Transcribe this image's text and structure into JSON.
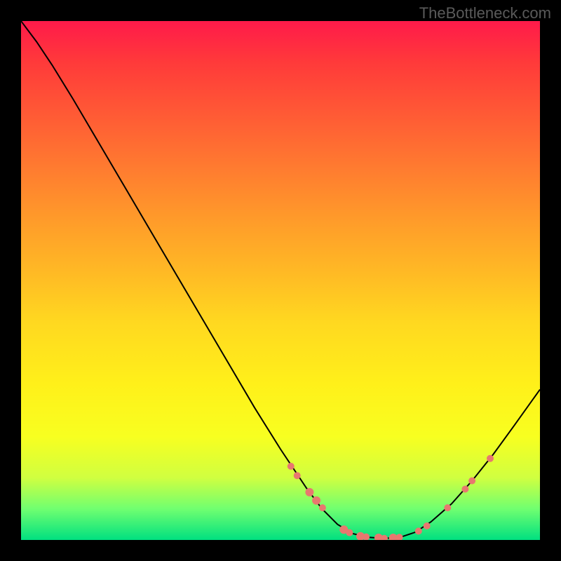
{
  "watermark": "TheBottleneck.com",
  "chart_data": {
    "type": "line",
    "title": "",
    "xlabel": "",
    "ylabel": "",
    "xlim": [
      0,
      100
    ],
    "ylim": [
      0,
      100
    ],
    "curve": {
      "points": [
        {
          "x": 0.0,
          "y": 100.0
        },
        {
          "x": 3.0,
          "y": 96.0
        },
        {
          "x": 6.0,
          "y": 91.5
        },
        {
          "x": 10.0,
          "y": 85.0
        },
        {
          "x": 15.0,
          "y": 76.5
        },
        {
          "x": 20.0,
          "y": 68.0
        },
        {
          "x": 25.0,
          "y": 59.5
        },
        {
          "x": 30.0,
          "y": 51.0
        },
        {
          "x": 35.0,
          "y": 42.5
        },
        {
          "x": 40.0,
          "y": 34.0
        },
        {
          "x": 45.0,
          "y": 25.5
        },
        {
          "x": 50.0,
          "y": 17.5
        },
        {
          "x": 55.0,
          "y": 10.0
        },
        {
          "x": 58.0,
          "y": 6.0
        },
        {
          "x": 61.0,
          "y": 3.0
        },
        {
          "x": 64.0,
          "y": 1.2
        },
        {
          "x": 67.0,
          "y": 0.5
        },
        {
          "x": 70.0,
          "y": 0.3
        },
        {
          "x": 73.0,
          "y": 0.5
        },
        {
          "x": 76.0,
          "y": 1.5
        },
        {
          "x": 79.0,
          "y": 3.5
        },
        {
          "x": 83.0,
          "y": 7.0
        },
        {
          "x": 87.0,
          "y": 11.5
        },
        {
          "x": 91.0,
          "y": 16.5
        },
        {
          "x": 95.0,
          "y": 22.0
        },
        {
          "x": 100.0,
          "y": 29.0
        }
      ]
    },
    "markers": [
      {
        "x": 52.0,
        "y": 14.2,
        "r": 5
      },
      {
        "x": 53.2,
        "y": 12.4,
        "r": 5
      },
      {
        "x": 55.6,
        "y": 9.2,
        "r": 6
      },
      {
        "x": 56.9,
        "y": 7.6,
        "r": 6
      },
      {
        "x": 58.1,
        "y": 6.2,
        "r": 5
      },
      {
        "x": 62.2,
        "y": 2.0,
        "r": 6
      },
      {
        "x": 63.3,
        "y": 1.4,
        "r": 5
      },
      {
        "x": 65.4,
        "y": 0.7,
        "r": 6
      },
      {
        "x": 66.5,
        "y": 0.6,
        "r": 5
      },
      {
        "x": 68.9,
        "y": 0.4,
        "r": 6
      },
      {
        "x": 70.0,
        "y": 0.3,
        "r": 5
      },
      {
        "x": 71.7,
        "y": 0.4,
        "r": 6
      },
      {
        "x": 72.9,
        "y": 0.5,
        "r": 5
      },
      {
        "x": 76.6,
        "y": 1.7,
        "r": 5
      },
      {
        "x": 78.2,
        "y": 2.7,
        "r": 5
      },
      {
        "x": 82.2,
        "y": 6.2,
        "r": 5
      },
      {
        "x": 85.6,
        "y": 9.8,
        "r": 5
      },
      {
        "x": 86.9,
        "y": 11.4,
        "r": 5
      },
      {
        "x": 90.4,
        "y": 15.7,
        "r": 5
      }
    ],
    "marker_color": "#e8786f",
    "line_color": "#000000"
  }
}
